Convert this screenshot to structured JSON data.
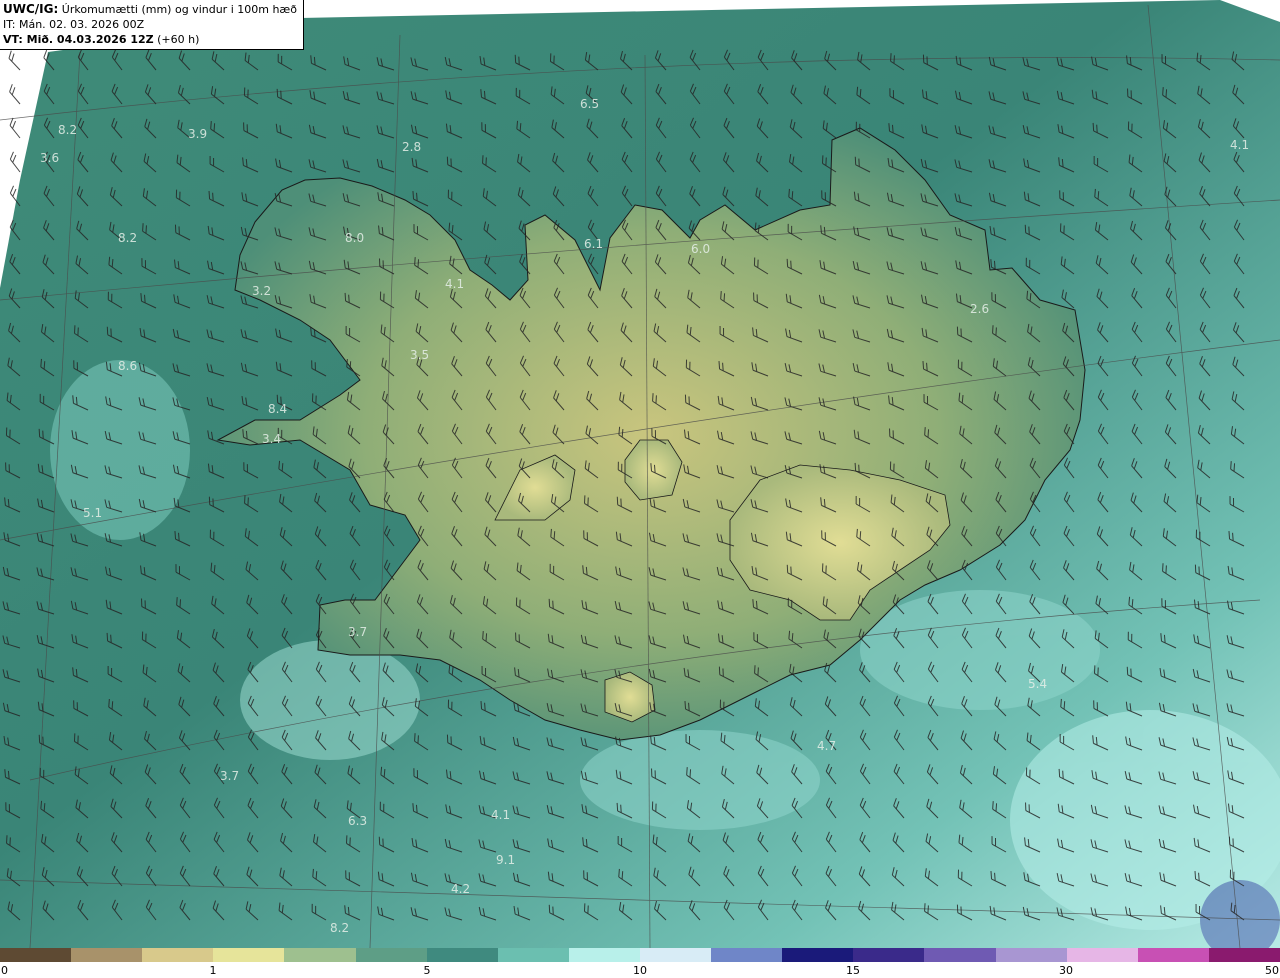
{
  "header": {
    "model": "UWC/IG:",
    "title": "Úrkomumætti (mm) og vindur i 100m hæð",
    "init_time": "IT: Mán. 02. 03. 2026 00Z",
    "valid_prefix": "VT: Mið. 04.03.2026 12Z",
    "valid_suffix": "(+60 h)"
  },
  "colorbar": {
    "ticks": [
      "0",
      "1",
      "5",
      "10",
      "15",
      "30",
      "50"
    ],
    "colors": [
      "#5e4a33",
      "#a8926a",
      "#d8c98b",
      "#e6e49a",
      "#9ec08f",
      "#5e9e86",
      "#3f8a7f",
      "#6bbfb0",
      "#b8f0ea",
      "#d8ecf6",
      "#6f86c8",
      "#1a1a7a",
      "#3a2a8a",
      "#6f5ab3",
      "#a896d2",
      "#e6b6e6",
      "#c850b4",
      "#8a1a6e"
    ]
  },
  "labels": [
    {
      "text": "6.5"
    },
    {
      "text": "3.9"
    },
    {
      "text": "8.2"
    },
    {
      "text": "3.6"
    },
    {
      "text": "2.8"
    },
    {
      "text": "4.1"
    },
    {
      "text": "8.2"
    },
    {
      "text": "8.0"
    },
    {
      "text": "6.1"
    },
    {
      "text": "6.0"
    },
    {
      "text": "3.2"
    },
    {
      "text": "4.1"
    },
    {
      "text": "2.6"
    },
    {
      "text": "3.5"
    },
    {
      "text": "8.6"
    },
    {
      "text": "8.4"
    },
    {
      "text": "3.4"
    },
    {
      "text": "5.1"
    },
    {
      "text": "3.7"
    },
    {
      "text": "5.4"
    },
    {
      "text": "4.7"
    },
    {
      "text": "3.7"
    },
    {
      "text": "4.1"
    },
    {
      "text": "6.3"
    },
    {
      "text": "9.1"
    },
    {
      "text": "4.2"
    },
    {
      "text": "8.2"
    }
  ]
}
